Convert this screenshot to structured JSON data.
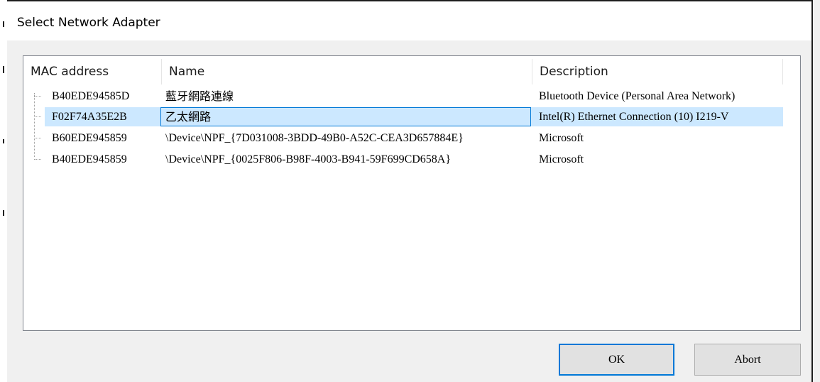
{
  "window": {
    "title": "Select Network Adapter"
  },
  "table": {
    "columns": [
      "MAC address",
      "Name",
      "Description"
    ],
    "rows": [
      {
        "mac": "B40EDE94585D",
        "name": "藍牙網路連線",
        "description": "Bluetooth Device (Personal Area Network)",
        "selected": false
      },
      {
        "mac": "F02F74A35E2B",
        "name": "乙太網路",
        "description": "Intel(R) Ethernet Connection (10) I219-V",
        "selected": true
      },
      {
        "mac": "B60EDE945859",
        "name": "\\Device\\NPF_{7D031008-3BDD-49B0-A52C-CEA3D657884E}",
        "description": "Microsoft",
        "selected": false
      },
      {
        "mac": "B40EDE945859",
        "name": "\\Device\\NPF_{0025F806-B98F-4003-B941-59F699CD658A}",
        "description": "Microsoft",
        "selected": false
      }
    ]
  },
  "buttons": {
    "ok": "OK",
    "abort": "Abort"
  },
  "colors": {
    "selection": "#cce8ff",
    "focus_border": "#0078d7",
    "dialog_bg": "#f0f0f0"
  }
}
